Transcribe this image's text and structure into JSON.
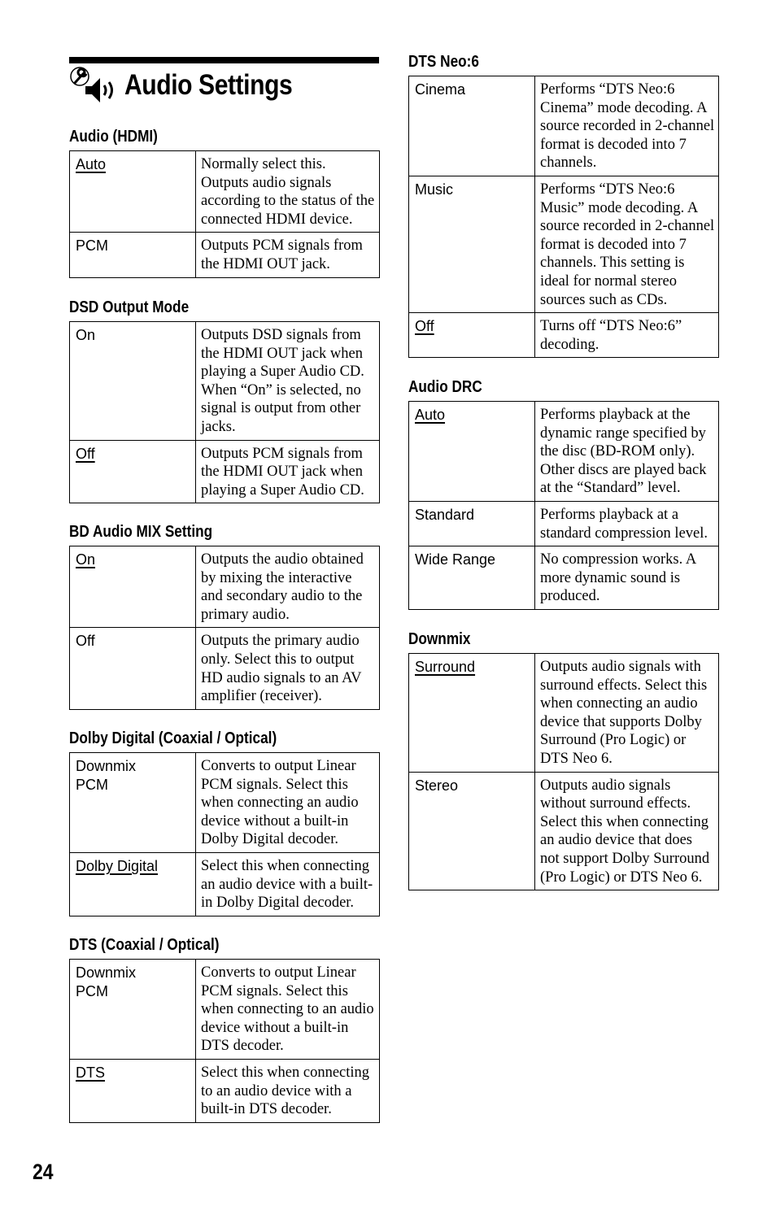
{
  "page": {
    "title": "Audio Settings",
    "page_number": "24",
    "icon": "wrench-speaker-icon"
  },
  "sections": {
    "audio_hdmi": {
      "heading": "Audio (HDMI)",
      "rows": [
        {
          "option": "Auto",
          "default": true,
          "desc": "Normally select this. Outputs audio signals according to the status of the connected HDMI device."
        },
        {
          "option": "PCM",
          "default": false,
          "desc": "Outputs PCM signals from the HDMI OUT jack."
        }
      ]
    },
    "dsd_output_mode": {
      "heading": "DSD Output Mode",
      "rows": [
        {
          "option": "On",
          "default": false,
          "desc": "Outputs DSD signals from the HDMI OUT jack when playing a Super Audio CD. When “On” is selected, no signal is output from other jacks."
        },
        {
          "option": "Off",
          "default": true,
          "desc": "Outputs PCM signals from the HDMI OUT jack when playing a Super Audio CD."
        }
      ]
    },
    "bd_audio_mix": {
      "heading": "BD Audio MIX Setting",
      "rows": [
        {
          "option": "On",
          "default": true,
          "desc": "Outputs the audio obtained by mixing the interactive and secondary audio to the primary audio."
        },
        {
          "option": "Off",
          "default": false,
          "desc": "Outputs the primary audio only. Select this to output HD audio signals to an AV amplifier (receiver)."
        }
      ]
    },
    "dolby_digital": {
      "heading": "Dolby Digital (Coaxial / Optical)",
      "rows": [
        {
          "option": "Downmix PCM",
          "default": false,
          "desc": "Converts to output Linear PCM signals. Select this when connecting an audio device without a built-in Dolby Digital decoder."
        },
        {
          "option": "Dolby Digital",
          "default": true,
          "desc": "Select this when connecting an audio device with a built-in Dolby Digital decoder."
        }
      ]
    },
    "dts": {
      "heading": "DTS (Coaxial / Optical)",
      "rows": [
        {
          "option": "Downmix PCM",
          "default": false,
          "desc": "Converts to output Linear PCM signals. Select this when connecting to an audio device without a built-in DTS decoder."
        },
        {
          "option": "DTS",
          "default": true,
          "desc": "Select this when connecting to an audio device with a built-in DTS decoder."
        }
      ]
    },
    "dts_neo6": {
      "heading": "DTS Neo:6",
      "rows": [
        {
          "option": "Cinema",
          "default": false,
          "desc": "Performs “DTS Neo:6 Cinema” mode decoding. A source recorded in 2-channel format is decoded into 7 channels."
        },
        {
          "option": "Music",
          "default": false,
          "desc": "Performs “DTS Neo:6 Music” mode decoding. A source recorded in 2-channel format is decoded into 7 channels. This setting is ideal for normal stereo sources such as CDs."
        },
        {
          "option": "Off",
          "default": true,
          "desc": "Turns off “DTS Neo:6” decoding."
        }
      ]
    },
    "audio_drc": {
      "heading": "Audio DRC",
      "rows": [
        {
          "option": "Auto",
          "default": true,
          "desc": "Performs playback at the dynamic range specified by the disc (BD-ROM only). Other discs are played back at the “Standard” level."
        },
        {
          "option": "Standard",
          "default": false,
          "desc": "Performs playback at a standard compression level."
        },
        {
          "option": "Wide Range",
          "default": false,
          "desc": "No compression works. A more dynamic sound is produced."
        }
      ]
    },
    "downmix": {
      "heading": "Downmix",
      "rows": [
        {
          "option": "Surround",
          "default": true,
          "desc": "Outputs audio signals with surround effects. Select this when connecting an audio device that supports Dolby Surround (Pro Logic) or DTS Neo 6."
        },
        {
          "option": "Stereo",
          "default": false,
          "desc": "Outputs audio signals without surround effects. Select this when connecting an audio device that does not support Dolby Surround (Pro Logic) or DTS Neo 6."
        }
      ]
    }
  }
}
